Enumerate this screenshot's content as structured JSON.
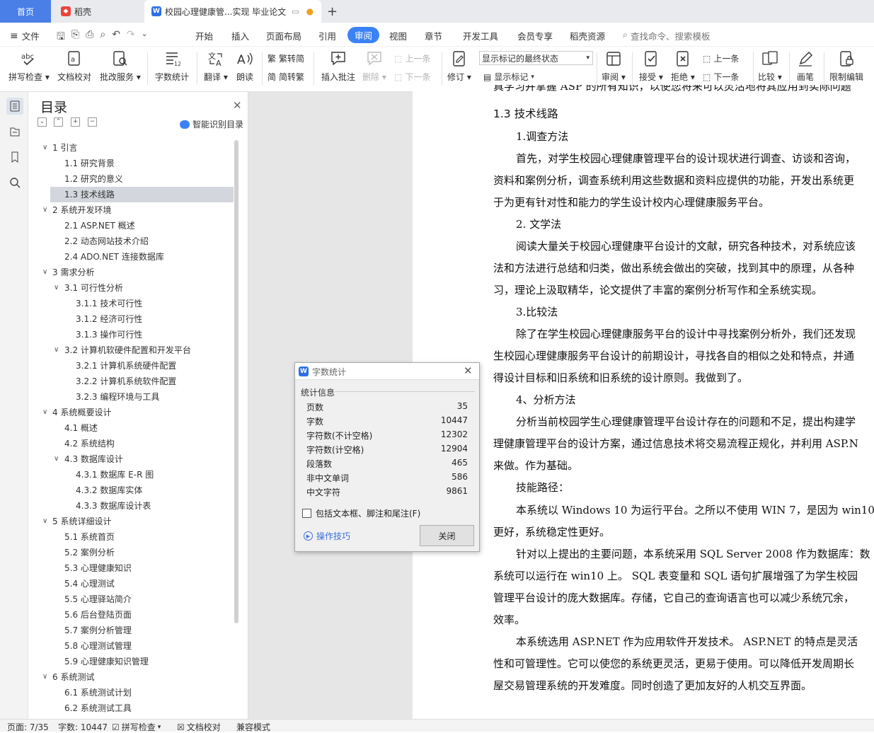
{
  "tabs": {
    "home": "首页",
    "daoke": "稻壳",
    "doc": "校园心理健康管...实现 毕业论文",
    "add": "+"
  },
  "menu": {
    "file": "文件",
    "items": [
      "开始",
      "插入",
      "页面布局",
      "引用",
      "审阅",
      "视图",
      "章节",
      "开发工具",
      "会员专享",
      "稻壳资源"
    ],
    "search": "查找命令、搜索模板"
  },
  "ribbon": {
    "spell": "拼写检查",
    "doccheck": "文档校对",
    "batch": "批改服务",
    "wordcount": "字数统计",
    "translate": "翻译",
    "read": "朗读",
    "trad": "繁转简",
    "simp": "简转繁",
    "insert_comment": "插入批注",
    "delete": "删除",
    "prev_comment": "上一条",
    "next_comment": "下一条",
    "revise": "修订",
    "markup_state": "显示标记的最终状态",
    "show_markup": "显示标记",
    "review_pane": "审阅",
    "accept": "接受",
    "reject": "拒绝",
    "prev_change": "上一条",
    "next_change": "下一条",
    "compare": "比较",
    "pen": "画笔",
    "restrict": "限制编辑"
  },
  "toc": {
    "title": "目录",
    "smart": "智能识别目录",
    "items": [
      {
        "text": "1  引言",
        "level": 1,
        "expand": true
      },
      {
        "text": "1.1  研究背景",
        "level": 2
      },
      {
        "text": "1.2  研究的意义",
        "level": 2
      },
      {
        "text": "1.3  技术线路",
        "level": 2,
        "selected": true
      },
      {
        "text": "2  系统开发环境",
        "level": 1,
        "expand": true
      },
      {
        "text": "2.1 ASP.NET 概述",
        "level": 2
      },
      {
        "text": "2.2  动态网站技术介绍",
        "level": 2
      },
      {
        "text": "2.4 ADO.NET 连接数据库",
        "level": 2
      },
      {
        "text": "3  需求分析",
        "level": 1,
        "expand": true
      },
      {
        "text": "3.1  可行性分析",
        "level": 2,
        "expand": true
      },
      {
        "text": "3.1.1  技术可行性",
        "level": 3
      },
      {
        "text": "3.1.2  经济可行性",
        "level": 3
      },
      {
        "text": "3.1.3  操作可行性",
        "level": 3
      },
      {
        "text": "3.2  计算机软硬件配置和开发平台",
        "level": 2,
        "expand": true
      },
      {
        "text": "3.2.1 计算机系统硬件配置",
        "level": 3
      },
      {
        "text": "3.2.2 计算机系统软件配置",
        "level": 3
      },
      {
        "text": "3.2.3 编程环境与工具",
        "level": 3
      },
      {
        "text": "4 系统概要设计",
        "level": 1,
        "expand": true
      },
      {
        "text": "4.1  概述",
        "level": 2
      },
      {
        "text": "4.2  系统结构",
        "level": 2
      },
      {
        "text": "4.3  数据库设计",
        "level": 2,
        "expand": true
      },
      {
        "text": "4.3.1  数据库 E-R 图",
        "level": 3
      },
      {
        "text": "4.3.2  数据库实体",
        "level": 3
      },
      {
        "text": "4.3.3 数据库设计表",
        "level": 3
      },
      {
        "text": "5 系统详细设计",
        "level": 1,
        "expand": true
      },
      {
        "text": "5.1  系统首页",
        "level": 2
      },
      {
        "text": "5.2 案例分析",
        "level": 2
      },
      {
        "text": "5.3 心理健康知识",
        "level": 2
      },
      {
        "text": "5.4 心理测试",
        "level": 2
      },
      {
        "text": "5.5 心理驿站简介",
        "level": 2
      },
      {
        "text": "5.6 后台登陆页面",
        "level": 2
      },
      {
        "text": "5.7 案例分析管理",
        "level": 2
      },
      {
        "text": "5.8 心理测试管理",
        "level": 2
      },
      {
        "text": "5.9 心理健康知识管理",
        "level": 2
      },
      {
        "text": "6 系统测试",
        "level": 1,
        "expand": true
      },
      {
        "text": "6.1 系统测试计划",
        "level": 2
      },
      {
        "text": "6.2  系统测试工具",
        "level": 2
      }
    ]
  },
  "document": {
    "lines": [
      {
        "text": "真学习并掌握 ASP 的所有知识，以使您将来可以灵活地将其应用到实际问题",
        "indent": false
      },
      {
        "text": "1.3  技术线路",
        "heading": true
      },
      {
        "text": "1.调查方法",
        "indent": true
      },
      {
        "text": "首先，对学生校园心理健康管理平台的设计现状进行调查、访谈和咨询，",
        "indent": true
      },
      {
        "text": "资料和案例分析，调查系统利用这些数据和资料应提供的功能，开发出系统更",
        "indent": false
      },
      {
        "text": "于为更有针对性和能力的学生设计校内心理健康服务平台。",
        "indent": false
      },
      {
        "text": "2. 文学法",
        "indent": true
      },
      {
        "text": "阅读大量关于校园心理健康平台设计的文献，研究各种技术，对系统应该",
        "indent": true
      },
      {
        "text": "法和方法进行总结和归类，做出系统会做出的突破，找到其中的原理，从各种",
        "indent": false
      },
      {
        "text": "习，理论上汲取精华，论文提供了丰富的案例分析写作和全系统实现。",
        "indent": false
      },
      {
        "text": "3.比较法",
        "indent": true
      },
      {
        "text": "除了在学生校园心理健康服务平台的设计中寻找案例分析外，我们还发现",
        "indent": true
      },
      {
        "text": "生校园心理健康服务平台设计的前期设计，寻找各自的相似之处和特点，并通",
        "indent": false
      },
      {
        "text": "得设计目标和旧系统和旧系统的设计原则。我做到了。",
        "indent": false
      },
      {
        "text": "4、分析方法",
        "indent": true
      },
      {
        "text": "分析当前校园学生心理健康管理平台设计存在的问题和不足，提出构建学",
        "indent": true
      },
      {
        "text": "理健康管理平台的设计方案，通过信息技术将交易流程正规化，并利用 ASP.N",
        "indent": false
      },
      {
        "text": "来做。作为基础。",
        "indent": false
      },
      {
        "text": "技能路径：",
        "indent": true
      },
      {
        "text": "本系统以 Windows 10 为运行平台。之所以不使用 WIN 7，是因为 win10",
        "indent": true
      },
      {
        "text": "更好，系统稳定性更好。",
        "indent": false
      },
      {
        "text": "针对以上提出的主要问题，本系统采用 SQL Server 2008 作为数据库：数",
        "indent": true
      },
      {
        "text": "系统可以运行在 win10 上。 SQL 表变量和 SQL 语句扩展增强了为学生校园",
        "indent": false
      },
      {
        "text": "管理平台设计的庞大数据库。存储，它自己的查询语言也可以减少系统冗余，",
        "indent": false
      },
      {
        "text": "效率。",
        "indent": false
      },
      {
        "text": "本系统选用 ASP.NET 作为应用软件开发技术。 ASP.NET 的特点是灵活",
        "indent": true
      },
      {
        "text": "性和可管理性。它可以使您的系统更灵活，更易于使用。可以降低开发周期长",
        "indent": false
      },
      {
        "text": "屋交易管理系统的开发难度。同时创造了更加友好的人机交互界面。",
        "indent": false
      }
    ]
  },
  "dialog": {
    "title": "字数统计",
    "group": "统计信息",
    "stats": [
      {
        "label": "页数",
        "value": "35"
      },
      {
        "label": "字数",
        "value": "10447"
      },
      {
        "label": "字符数(不计空格)",
        "value": "12302"
      },
      {
        "label": "字符数(计空格)",
        "value": "12904"
      },
      {
        "label": "段落数",
        "value": "465"
      },
      {
        "label": "非中文单词",
        "value": "586"
      },
      {
        "label": "中文字符",
        "value": "9861"
      }
    ],
    "include_label": "包括文本框、脚注和尾注(F)",
    "include_checked": false,
    "tips": "操作技巧",
    "close": "关闭"
  },
  "status": {
    "page": "页面: 7/35",
    "words": "字数: 10447",
    "spell": "拼写检查",
    "doccheck": "文档校对",
    "compat": "兼容模式"
  },
  "colors": {
    "accent": "#3b82f6",
    "home_tab": "#4a7fe8",
    "wps_logo": "#2f6fe4",
    "daoke_logo": "#e8453c"
  }
}
